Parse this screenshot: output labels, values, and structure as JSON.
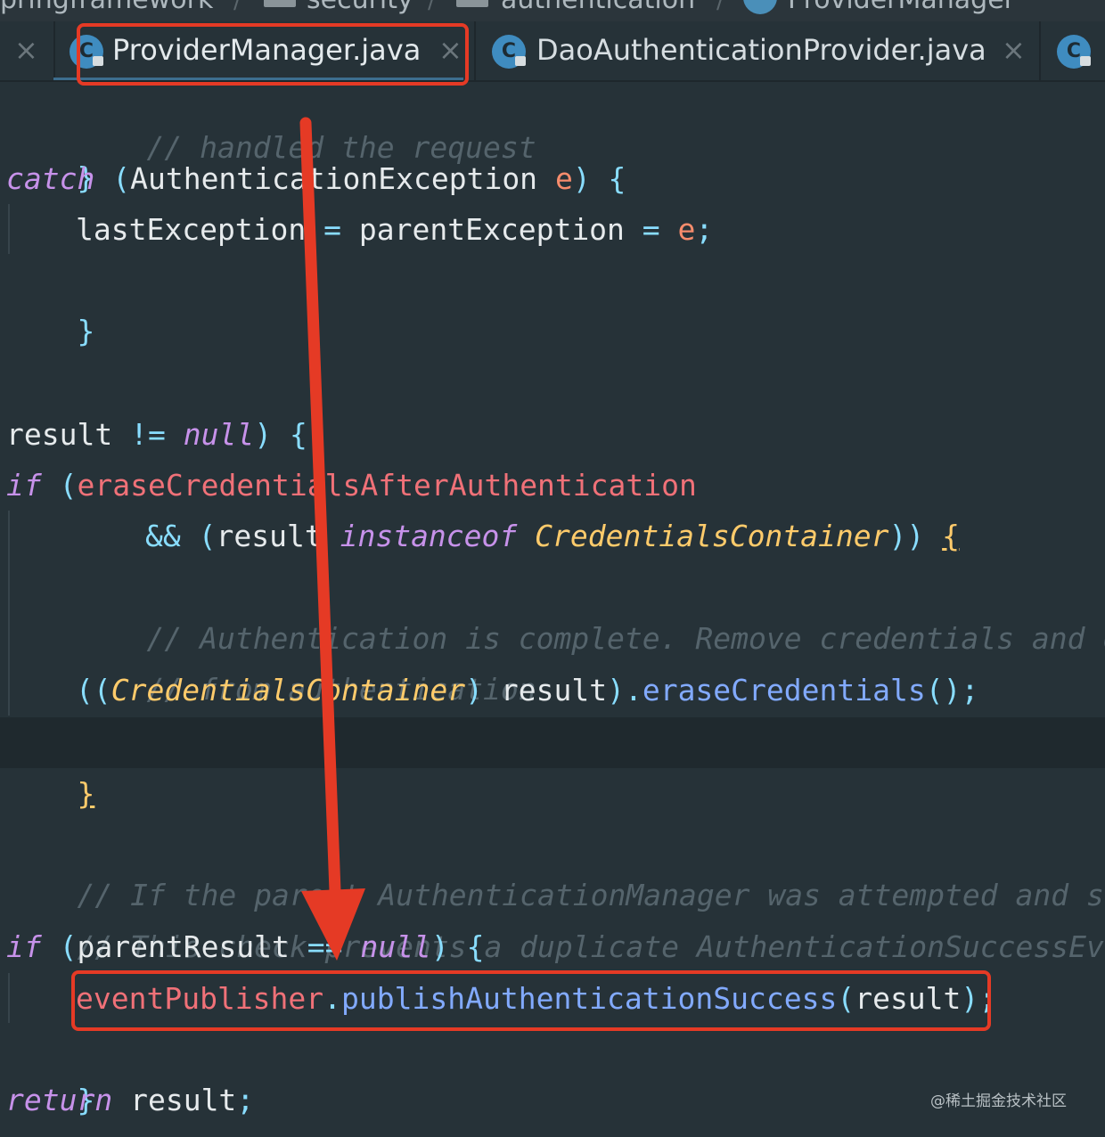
{
  "breadcrumb": [
    "pringframework",
    "security",
    "authentication",
    "ProviderManager"
  ],
  "tabs": [
    {
      "label": "ProviderManager.java",
      "icon": "c-class-icon",
      "active": true
    },
    {
      "label": "DaoAuthenticationProvider.java",
      "icon": "c-class-icon",
      "active": false
    }
  ],
  "icons": {
    "class_icon_letter": "C",
    "close_glyph": "×"
  },
  "colors": {
    "annotation": "#e53a25",
    "background": "#263238"
  },
  "code": {
    "l0": "// handled the request",
    "l1": "}",
    "l2_kw": "catch",
    "l2_type": "AuthenticationException",
    "l2_param": "e",
    "l3_a": "lastException",
    "l3_b": "parentException",
    "l3_c": "e",
    "l4": "}",
    "l8_a": "result",
    "l8_null": "null",
    "l9_kw": "if",
    "l9_field": "eraseCredentialsAfterAuthentication",
    "l10_and": "&&",
    "l10_var": "result",
    "l10_kw": "instanceof",
    "l10_type": "CredentialsContainer",
    "l11": "// Authentication is complete. Remove credentials and other secret data",
    "l12": "// from authentication",
    "l13_type": "CredentialsContainer",
    "l13_var": "result",
    "l13_method": "eraseCredentials",
    "l14": "}",
    "l15": "// If the parent AuthenticationManager was attempted and successful then it will publish an",
    "l16": "// This check prevents a duplicate AuthenticationSuccessEvent if the parent",
    "l17_kw": "if",
    "l17_var": "parentResult",
    "l17_null": "null",
    "l18_field": "eventPublisher",
    "l18_method": "publishAuthenticationSuccess",
    "l18_arg": "result",
    "l19": "}",
    "l20_kw": "return",
    "l20_var": "result"
  },
  "watermark": "@稀土掘金技术社区"
}
